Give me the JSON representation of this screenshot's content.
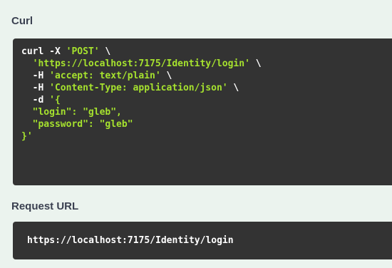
{
  "curl_section": {
    "title": "Curl",
    "lines": [
      {
        "cmd": "curl -X ",
        "arg": "'POST'",
        "tail": " \\"
      },
      {
        "cmd": "  ",
        "arg": "'https://localhost:7175/Identity/login'",
        "tail": " \\"
      },
      {
        "cmd": "  -H ",
        "arg": "'accept: text/plain'",
        "tail": " \\"
      },
      {
        "cmd": "  -H ",
        "arg": "'Content-Type: application/json'",
        "tail": " \\"
      },
      {
        "cmd": "  -d ",
        "arg": "'{",
        "tail": ""
      },
      {
        "cmd": "",
        "arg": "  \"login\": \"gleb\",",
        "tail": ""
      },
      {
        "cmd": "",
        "arg": "  \"password\": \"gleb\"",
        "tail": ""
      },
      {
        "cmd": "",
        "arg": "}'",
        "tail": ""
      }
    ]
  },
  "request_url_section": {
    "title": "Request URL",
    "url": "https://localhost:7175/Identity/login"
  },
  "colors": {
    "background": "#ebf3ee",
    "code_background": "#333333",
    "string_color": "#a6e22e",
    "title_color": "#3b4151"
  }
}
